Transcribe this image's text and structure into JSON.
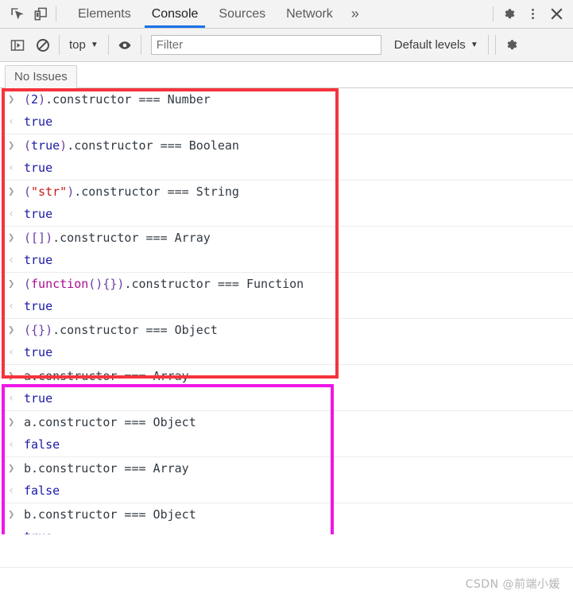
{
  "tabbar": {
    "inspect_icon": "inspect-element-icon",
    "device_icon": "device-toolbar-icon",
    "tabs": [
      {
        "label": "Elements",
        "active": false
      },
      {
        "label": "Console",
        "active": true
      },
      {
        "label": "Sources",
        "active": false
      },
      {
        "label": "Network",
        "active": false
      }
    ],
    "more_label": "»",
    "settings_icon": "gear-icon",
    "menu_icon": "more-vertical-icon",
    "close_icon": "close-icon"
  },
  "console_toolbar": {
    "sidebar_toggle_icon": "console-sidebar-icon",
    "clear_icon": "clear-console-icon",
    "context_label": "top",
    "caret": "▼",
    "eye_icon": "live-expression-icon",
    "filter_placeholder": "Filter",
    "filter_value": "",
    "levels_label": "Default levels",
    "settings_icon": "console-settings-gear-icon"
  },
  "issues": {
    "label": "No Issues"
  },
  "console": {
    "input_marker": "❯",
    "output_marker": "‹",
    "prompt_marker": "❯",
    "entries": [
      {
        "input_tokens": [
          {
            "t": "paren",
            "v": "("
          },
          {
            "t": "num",
            "v": "2"
          },
          {
            "t": "paren",
            "v": ")"
          },
          {
            "t": "punc",
            "v": ".constructor === Number"
          }
        ],
        "input_plain": "(2).constructor === Number",
        "output": "true"
      },
      {
        "input_tokens": [
          {
            "t": "paren",
            "v": "("
          },
          {
            "t": "num",
            "v": "true"
          },
          {
            "t": "paren",
            "v": ")"
          },
          {
            "t": "punc",
            "v": ".constructor === Boolean"
          }
        ],
        "input_plain": "(true).constructor === Boolean",
        "output": "true"
      },
      {
        "input_tokens": [
          {
            "t": "paren",
            "v": "("
          },
          {
            "t": "str",
            "v": "\"str\""
          },
          {
            "t": "paren",
            "v": ")"
          },
          {
            "t": "punc",
            "v": ".constructor === String"
          }
        ],
        "input_plain": "(\"str\").constructor === String",
        "output": "true"
      },
      {
        "input_tokens": [
          {
            "t": "paren",
            "v": "([])"
          },
          {
            "t": "punc",
            "v": ".constructor === Array"
          }
        ],
        "input_plain": "([]).constructor === Array",
        "output": "true"
      },
      {
        "input_tokens": [
          {
            "t": "paren",
            "v": "("
          },
          {
            "t": "kw",
            "v": "function"
          },
          {
            "t": "paren",
            "v": "(){})"
          },
          {
            "t": "punc",
            "v": ".constructor === Function"
          }
        ],
        "input_plain": "(function(){}).constructor === Function",
        "output": "true"
      },
      {
        "input_tokens": [
          {
            "t": "paren",
            "v": "({})"
          },
          {
            "t": "punc",
            "v": ".constructor === Object"
          }
        ],
        "input_plain": "({}).constructor === Object",
        "output": "true"
      },
      {
        "input_tokens": [
          {
            "t": "punc",
            "v": "a.constructor === Array"
          }
        ],
        "input_plain": "a.constructor === Array",
        "output": "true"
      },
      {
        "input_tokens": [
          {
            "t": "punc",
            "v": "a.constructor === Object"
          }
        ],
        "input_plain": "a.constructor === Object",
        "output": "false"
      },
      {
        "input_tokens": [
          {
            "t": "punc",
            "v": "b.constructor === Array"
          }
        ],
        "input_plain": "b.constructor === Array",
        "output": "false"
      },
      {
        "input_tokens": [
          {
            "t": "punc",
            "v": "b.constructor === Object"
          }
        ],
        "input_plain": "b.constructor === Object",
        "output": "true"
      }
    ]
  },
  "annotations": {
    "red_box_color": "#f6333c",
    "magenta_box_color": "#f016e8"
  },
  "watermark": {
    "text": "CSDN @前端小媛"
  }
}
